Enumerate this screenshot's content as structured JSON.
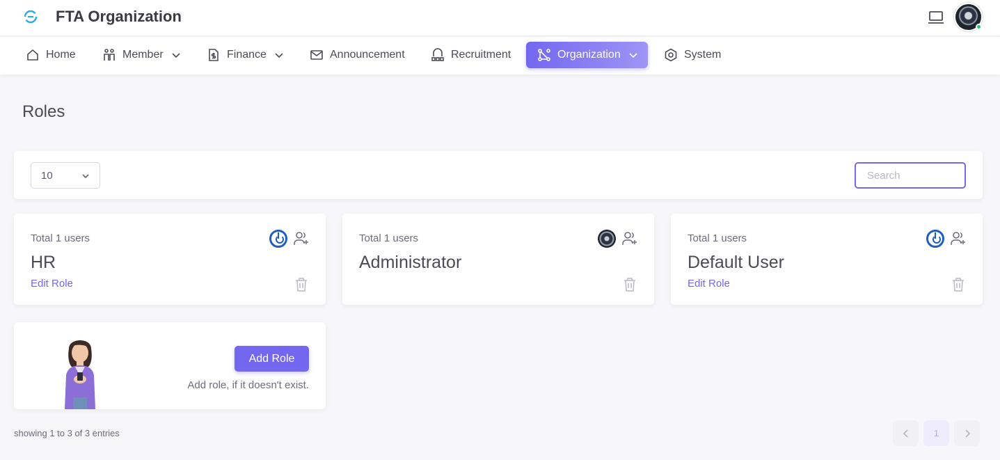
{
  "header": {
    "title": "FTA Organization"
  },
  "nav": {
    "items": [
      {
        "label": "Home"
      },
      {
        "label": "Member"
      },
      {
        "label": "Finance"
      },
      {
        "label": "Announcement"
      },
      {
        "label": "Recruitment"
      },
      {
        "label": "Organization"
      },
      {
        "label": "System"
      }
    ]
  },
  "page": {
    "title": "Roles"
  },
  "toolbar": {
    "page_size": "10",
    "search_placeholder": "Search"
  },
  "roles": [
    {
      "total": "Total 1 users",
      "name": "HR",
      "edit": "Edit Role"
    },
    {
      "total": "Total 1 users",
      "name": "Administrator",
      "edit": ""
    },
    {
      "total": "Total 1 users",
      "name": "Default User",
      "edit": "Edit Role"
    }
  ],
  "add_role": {
    "button": "Add Role",
    "hint": "Add role, if it doesn't exist."
  },
  "footer": {
    "showing": "showing 1 to 3 of 3 entries",
    "current_page": "1"
  },
  "colors": {
    "accent": "#7367f0",
    "online": "#28c76f"
  }
}
